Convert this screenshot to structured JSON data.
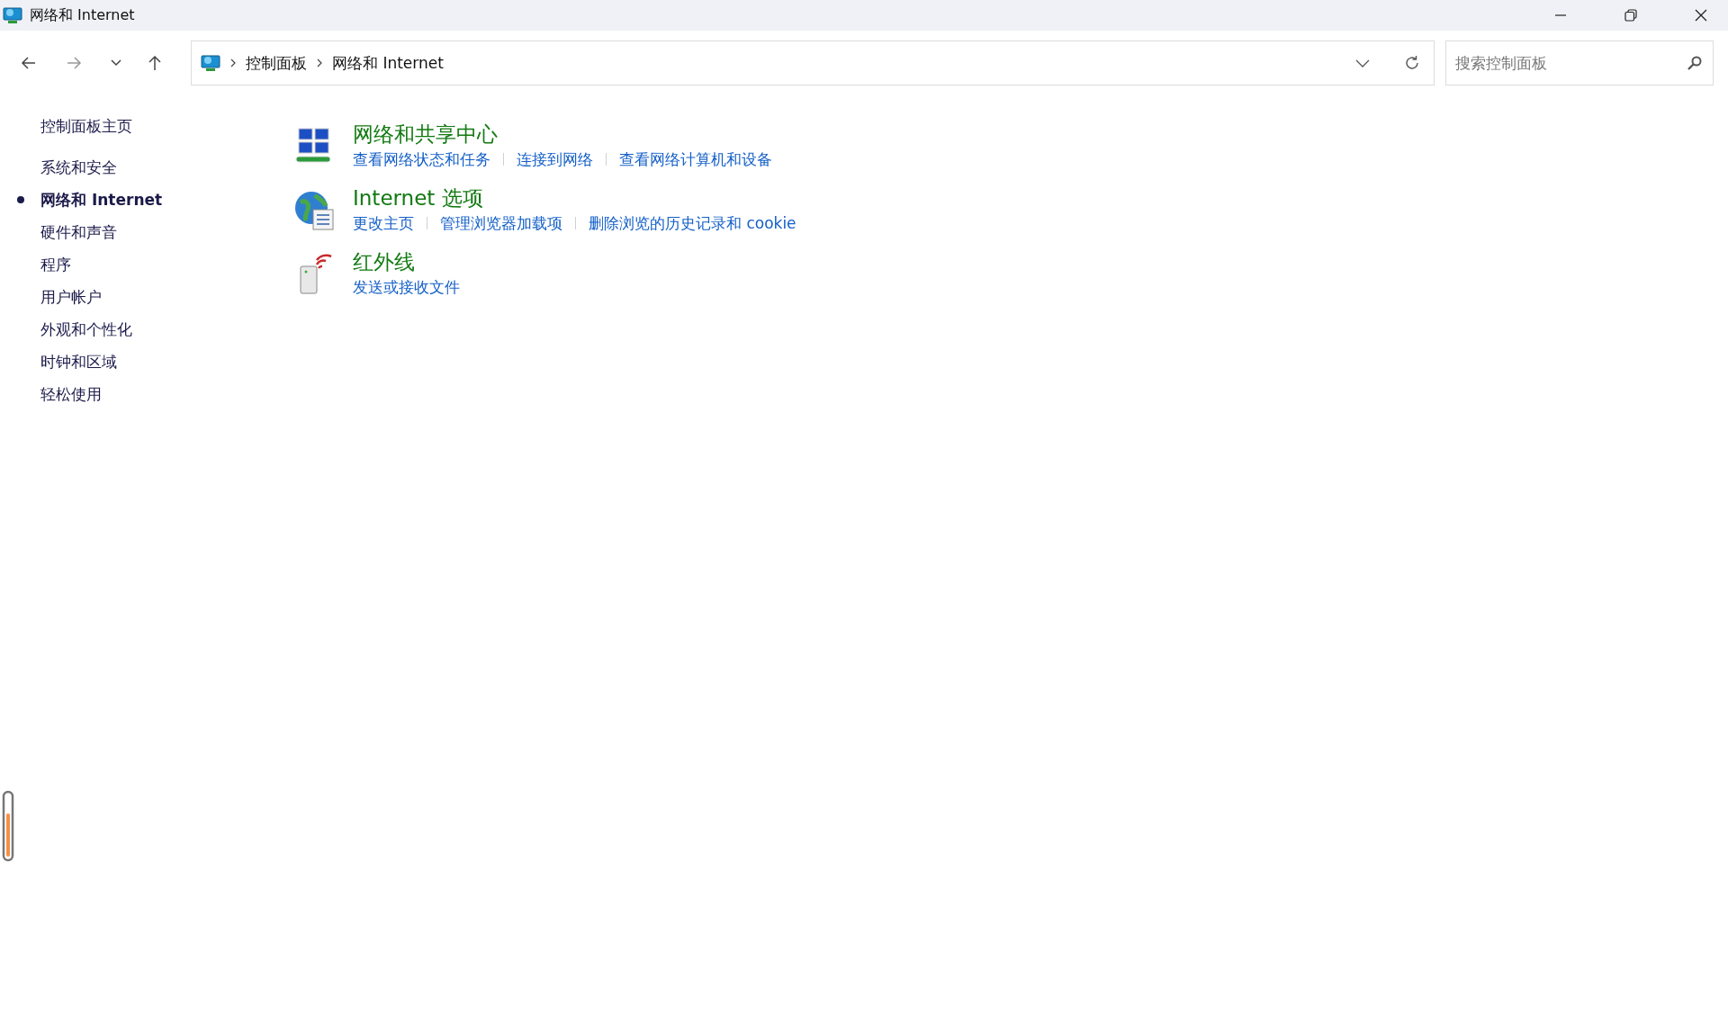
{
  "window": {
    "title": "网络和 Internet"
  },
  "address": {
    "crumbs": [
      "控制面板",
      "网络和 Internet"
    ]
  },
  "search": {
    "placeholder": "搜索控制面板"
  },
  "sidebar": {
    "home": "控制面板主页",
    "items": [
      {
        "label": "系统和安全",
        "selected": false
      },
      {
        "label": "网络和 Internet",
        "selected": true
      },
      {
        "label": "硬件和声音",
        "selected": false
      },
      {
        "label": "程序",
        "selected": false
      },
      {
        "label": "用户帐户",
        "selected": false
      },
      {
        "label": "外观和个性化",
        "selected": false
      },
      {
        "label": "时钟和区域",
        "selected": false
      },
      {
        "label": "轻松使用",
        "selected": false
      }
    ]
  },
  "categories": [
    {
      "kind": "network",
      "title": "网络和共享中心",
      "links": [
        "查看网络状态和任务",
        "连接到网络",
        "查看网络计算机和设备"
      ]
    },
    {
      "kind": "globe",
      "title": "Internet 选项",
      "links": [
        "更改主页",
        "管理浏览器加载项",
        "删除浏览的历史记录和 cookie"
      ]
    },
    {
      "kind": "infrared",
      "title": "红外线",
      "links": [
        "发送或接收文件"
      ]
    }
  ]
}
